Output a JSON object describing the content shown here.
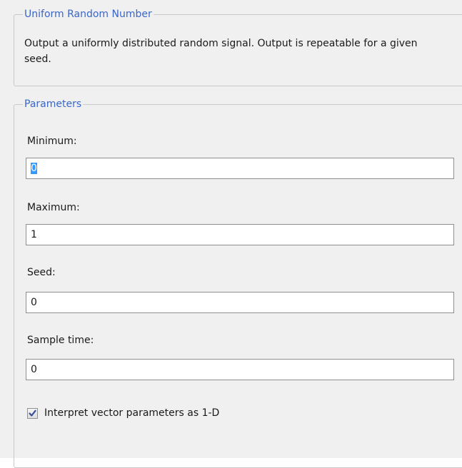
{
  "block": {
    "title": "Uniform Random Number",
    "description": "Output a uniformly distributed random signal.  Output is repeatable for a given seed."
  },
  "parameters": {
    "title": "Parameters",
    "minimum": {
      "label": "Minimum:",
      "value": "0"
    },
    "maximum": {
      "label": "Maximum:",
      "value": "1"
    },
    "seed": {
      "label": "Seed:",
      "value": "0"
    },
    "sample_time": {
      "label": "Sample time:",
      "value": "0"
    },
    "interpret_vector": {
      "label": "Interpret vector parameters as 1-D",
      "checked": true,
      "check_icon": "checkmark-icon"
    }
  },
  "colors": {
    "legend": "#3a66c8",
    "panel_background": "#f0f0f0",
    "group_border": "#c9c9c9",
    "input_border": "#8f8f8f",
    "selection": "#3399ff",
    "checkmark": "#3b4f9a"
  }
}
